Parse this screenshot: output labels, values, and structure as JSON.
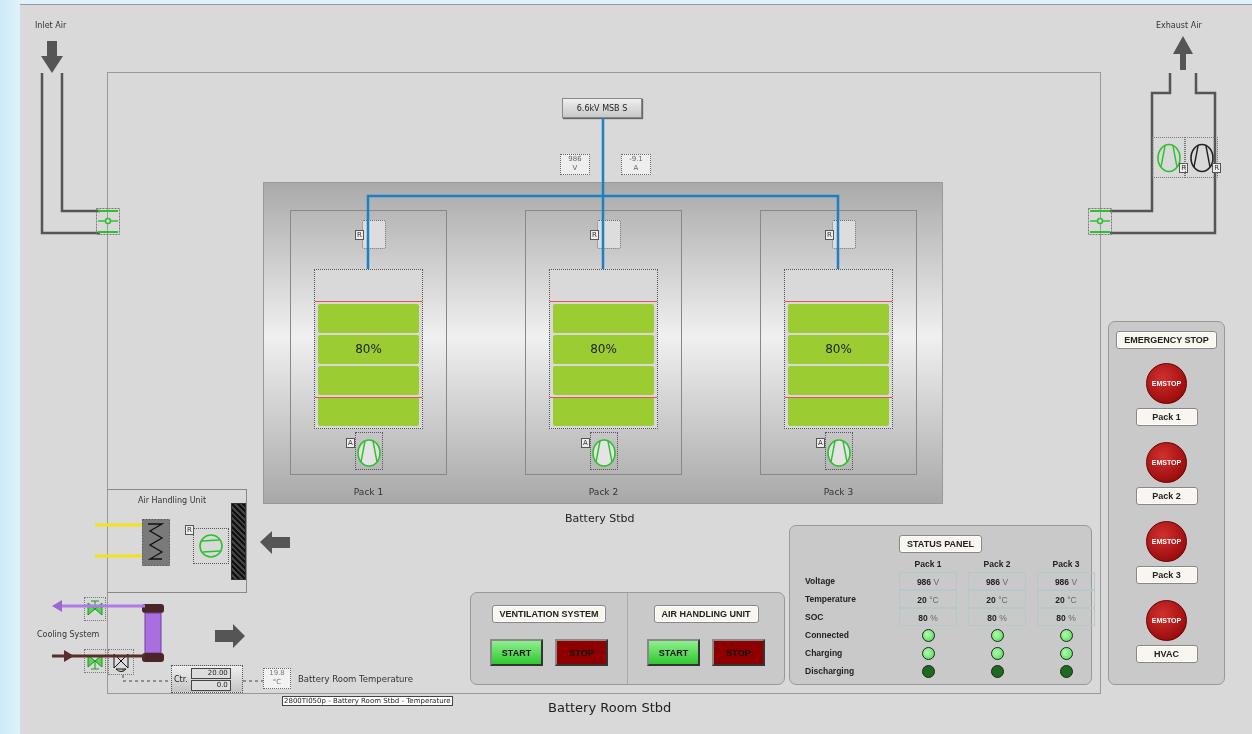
{
  "inlet": {
    "label": "Inlet Air"
  },
  "exhaust": {
    "label": "Exhaust Air",
    "fans": [
      {
        "tag": "R",
        "on": true
      },
      {
        "tag": "R",
        "on": false
      }
    ]
  },
  "bus": {
    "label": "6.6kV MSB S",
    "readings": [
      {
        "value": "986",
        "unit": "V"
      },
      {
        "value": "-9.1",
        "unit": "A"
      }
    ]
  },
  "battery": {
    "title": "Battery Stbd",
    "packs": [
      {
        "name": "Pack 1",
        "soc": "80%",
        "breaker_tag": "R",
        "fan_tag": "A",
        "fan_on": true
      },
      {
        "name": "Pack 2",
        "soc": "80%",
        "breaker_tag": "R",
        "fan_tag": "A",
        "fan_on": true
      },
      {
        "name": "Pack 3",
        "soc": "80%",
        "breaker_tag": "R",
        "fan_tag": "A",
        "fan_on": true
      }
    ]
  },
  "ahu": {
    "title": "Air Handling Unit",
    "fan_tag": "R",
    "fan_on": true
  },
  "cooling": {
    "label": "Cooling System",
    "controller": {
      "label": "Ctr.",
      "setpoint": "20.00",
      "output": "0.0"
    }
  },
  "temperature": {
    "value": "19.8",
    "unit": "°C",
    "label": "Battery Room Temperature",
    "tooltip": "2800TI050p - Battery Room Stbd - Temperature"
  },
  "room_title": "Battery Room Stbd",
  "control_groups": [
    {
      "title": "VENTILATION SYSTEM",
      "start": "START",
      "stop": "STOP"
    },
    {
      "title": "AIR HANDLING UNIT",
      "start": "START",
      "stop": "STOP"
    }
  ],
  "status_panel": {
    "title": "STATUS PANEL",
    "columns": [
      "Pack 1",
      "Pack 2",
      "Pack 3"
    ],
    "value_rows": [
      {
        "label": "Voltage",
        "cells": [
          {
            "value": "986",
            "unit": "V"
          },
          {
            "value": "986",
            "unit": "V"
          },
          {
            "value": "986",
            "unit": "V"
          }
        ]
      },
      {
        "label": "Temperature",
        "cells": [
          {
            "value": "20",
            "unit": "°C"
          },
          {
            "value": "20",
            "unit": "°C"
          },
          {
            "value": "20",
            "unit": "°C"
          }
        ]
      },
      {
        "label": "SOC",
        "cells": [
          {
            "value": "80",
            "unit": "%"
          },
          {
            "value": "80",
            "unit": "%"
          },
          {
            "value": "80",
            "unit": "%"
          }
        ]
      }
    ],
    "lamp_rows": [
      {
        "label": "Connected",
        "lamps": [
          {
            "on": true
          },
          {
            "on": true
          },
          {
            "on": true
          }
        ]
      },
      {
        "label": "Charging",
        "lamps": [
          {
            "on": true
          },
          {
            "on": true
          },
          {
            "on": true
          }
        ]
      },
      {
        "label": "Discharging",
        "lamps": [
          {
            "on": false
          },
          {
            "on": false
          },
          {
            "on": false
          }
        ]
      }
    ]
  },
  "emergency_stop": {
    "title": "EMERGENCY STOP",
    "buttons": [
      {
        "text": "EMSTOP",
        "label": "Pack 1"
      },
      {
        "text": "EMSTOP",
        "label": "Pack 2"
      },
      {
        "text": "EMSTOP",
        "label": "Pack 3"
      },
      {
        "text": "EMSTOP",
        "label": "HVAC"
      }
    ]
  }
}
